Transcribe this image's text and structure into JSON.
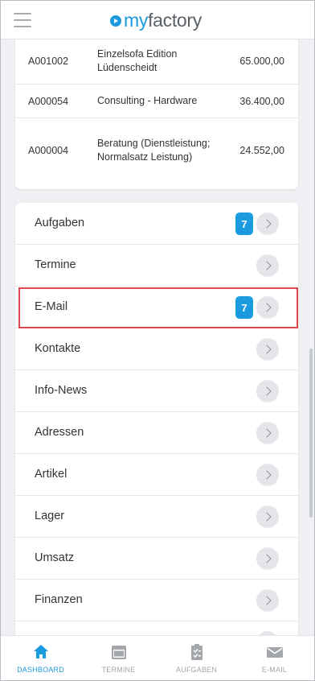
{
  "header": {
    "logo_text_my": "my",
    "logo_text_factory": "factory"
  },
  "top_table": {
    "rows": [
      {
        "id": "A001002",
        "name": "Einzelsofa Edition Lüdenscheidt",
        "amount": "65.000,00"
      },
      {
        "id": "A000054",
        "name": "Consulting - Hardware",
        "amount": "36.400,00"
      },
      {
        "id": "A000004",
        "name": "Beratung (Dienstleistung; Normalsatz Leistung)",
        "amount": "24.552,00"
      }
    ]
  },
  "menu": {
    "items": [
      {
        "label": "Aufgaben",
        "badge": "7"
      },
      {
        "label": "Termine",
        "badge": ""
      },
      {
        "label": "E-Mail",
        "badge": "7"
      },
      {
        "label": "Kontakte",
        "badge": ""
      },
      {
        "label": "Info-News",
        "badge": ""
      },
      {
        "label": "Adressen",
        "badge": ""
      },
      {
        "label": "Artikel",
        "badge": ""
      },
      {
        "label": "Lager",
        "badge": ""
      },
      {
        "label": "Umsatz",
        "badge": ""
      },
      {
        "label": "Finanzen",
        "badge": ""
      }
    ]
  },
  "bottom_nav": {
    "items": [
      {
        "label": "DASHBOARD",
        "icon": "home-icon",
        "active": true
      },
      {
        "label": "TERMINE",
        "icon": "calendar-icon",
        "active": false
      },
      {
        "label": "AUFGABEN",
        "icon": "clipboard-icon",
        "active": false
      },
      {
        "label": "E-MAIL",
        "icon": "mail-icon",
        "active": false
      }
    ]
  },
  "colors": {
    "accent": "#1a9be0",
    "highlight": "#e0474c"
  }
}
